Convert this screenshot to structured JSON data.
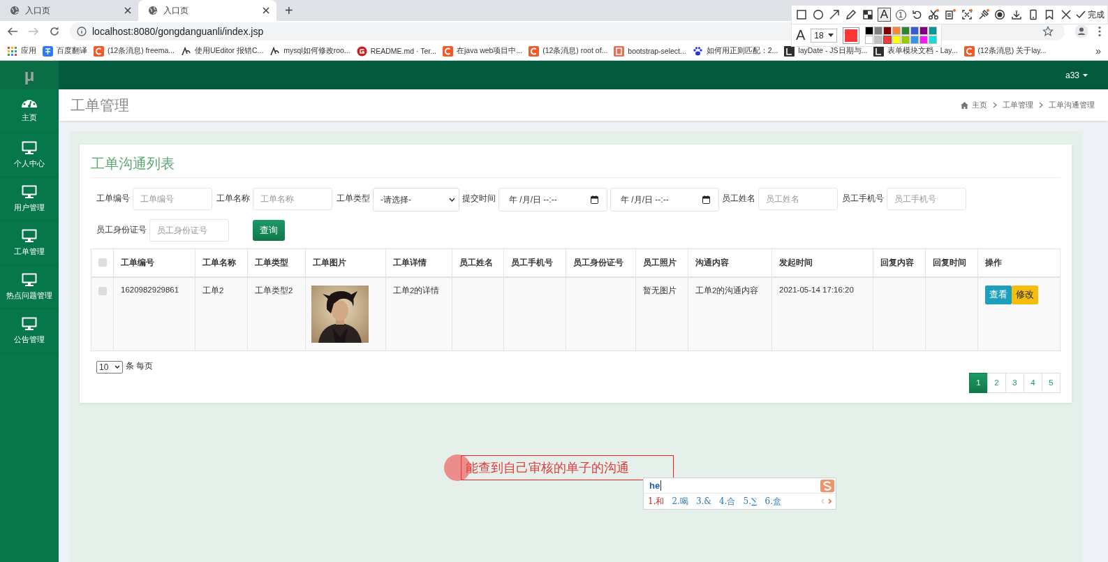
{
  "browser": {
    "tabs": [
      {
        "title": "入口页",
        "selected": false
      },
      {
        "title": "入口页",
        "selected": true
      }
    ],
    "new_tab": "+",
    "url": "localhost:8080/gongdanguanli/index.jsp",
    "bookmarks": [
      {
        "label": "应用",
        "kind": "apps"
      },
      {
        "label": "百度翻译",
        "kind": "translate"
      },
      {
        "label": "(12条消息) freema...",
        "kind": "csdn"
      },
      {
        "label": "使用UEditor 报错C...",
        "kind": "swirl"
      },
      {
        "label": "mysql如何修改roo...",
        "kind": "swirl"
      },
      {
        "label": "README.md · Ter...",
        "kind": "gitee"
      },
      {
        "label": "在java web项目中...",
        "kind": "csdn"
      },
      {
        "label": "(12条消息) root of...",
        "kind": "csdn"
      },
      {
        "label": "bootstrap-select...",
        "kind": "jian"
      },
      {
        "label": "如何用正则匹配：2...",
        "kind": "paw"
      },
      {
        "label": "layDate - JS日期与...",
        "kind": "layui"
      },
      {
        "label": "表单模块文档 - Lay...",
        "kind": "layui"
      },
      {
        "label": "(12条消息) 关于lay...",
        "kind": "csdn"
      }
    ],
    "bookmarks_more": "»"
  },
  "snip_toolbar": {
    "tools": [
      {
        "kind": "rect",
        "selected": false
      },
      {
        "kind": "circle",
        "selected": false
      },
      {
        "kind": "arrow",
        "selected": false
      },
      {
        "kind": "pencil",
        "selected": false
      },
      {
        "kind": "mosaic",
        "selected": false
      },
      {
        "kind": "text",
        "label": "A",
        "selected": true
      },
      {
        "kind": "number",
        "label": "1",
        "selected": false
      },
      {
        "kind": "undo",
        "selected": false
      },
      {
        "kind": "cut",
        "selected": false
      },
      {
        "kind": "ocr",
        "selected": false
      },
      {
        "kind": "scan",
        "selected": false
      },
      {
        "kind": "pin",
        "selected": false
      },
      {
        "kind": "record",
        "selected": false
      },
      {
        "kind": "download",
        "selected": false
      },
      {
        "kind": "phone",
        "selected": false
      },
      {
        "kind": "bookmark",
        "selected": false
      },
      {
        "kind": "close",
        "selected": false
      }
    ],
    "done": "完成",
    "font_icon": "A",
    "font_size": "18",
    "palette": [
      {
        "color": "#000000",
        "selected": false
      },
      {
        "color": "#808080",
        "selected": false
      },
      {
        "color": "#800000",
        "selected": false
      },
      {
        "color": "#f7883a",
        "selected": false
      },
      {
        "color": "#308430",
        "selected": false
      },
      {
        "color": "#385ad3",
        "selected": false
      },
      {
        "color": "#800080",
        "selected": false
      },
      {
        "color": "#009999",
        "selected": false
      },
      {
        "color": "#ffffff",
        "selected": false
      },
      {
        "color": "#c0c0c0",
        "selected": false
      },
      {
        "color": "#fb3838",
        "selected": true
      },
      {
        "color": "#ffff00",
        "selected": false
      },
      {
        "color": "#99cc00",
        "selected": false
      },
      {
        "color": "#3894e4",
        "selected": false
      },
      {
        "color": "#f31bf3",
        "selected": false
      },
      {
        "color": "#16dcdc",
        "selected": false
      }
    ]
  },
  "app": {
    "logo": "μ",
    "user": "a33"
  },
  "sidebar": {
    "items": [
      {
        "label": "主页",
        "kind": "dashboard"
      },
      {
        "label": "个人中心",
        "kind": "monitor"
      },
      {
        "label": "用户管理",
        "kind": "monitor"
      },
      {
        "label": "工单管理",
        "kind": "monitor"
      },
      {
        "label": "热点问题管理",
        "kind": "monitor"
      },
      {
        "label": "公告管理",
        "kind": "monitor"
      }
    ]
  },
  "page": {
    "title": "工单管理",
    "breadcrumb": [
      "主页",
      "工单管理",
      "工单沟通管理"
    ]
  },
  "card": {
    "title": "工单沟通列表",
    "filters": [
      {
        "kind": "text",
        "label": "工单编号",
        "placeholder": "工单编号"
      },
      {
        "kind": "text",
        "label": "工单名称",
        "placeholder": "工单名称"
      },
      {
        "kind": "select",
        "label": "工单类型",
        "value": "-请选择-"
      },
      {
        "kind": "daterange",
        "label": "提交时间",
        "values": [
          "年 /月/日 --:--",
          "年 /月/日 --:--"
        ]
      },
      {
        "kind": "text",
        "label": "员工姓名",
        "placeholder": "员工姓名"
      },
      {
        "kind": "text",
        "label": "员工手机号",
        "placeholder": "员工手机号"
      },
      {
        "kind": "text",
        "label": "员工身份证号",
        "placeholder": "员工身份证号"
      }
    ],
    "search_button": "查询"
  },
  "table": {
    "select_all": {
      "checked": false
    },
    "columns": [
      "工单编号",
      "工单名称",
      "工单类型",
      "工单图片",
      "工单详情",
      "员工姓名",
      "员工手机号",
      "员工身份证号",
      "员工照片",
      "沟通内容",
      "发起时间",
      "回复内容",
      "回复时间",
      "操作"
    ],
    "rows": [
      {
        "checked": false,
        "cells": [
          {
            "kind": "text",
            "text": "1620982929861"
          },
          {
            "kind": "text",
            "text": "工单2"
          },
          {
            "kind": "text",
            "text": "工单类型2"
          },
          {
            "kind": "picture"
          },
          {
            "kind": "text",
            "text": "工单2的详情"
          },
          {
            "kind": "empty"
          },
          {
            "kind": "empty"
          },
          {
            "kind": "empty"
          },
          {
            "kind": "text",
            "text": "暂无图片"
          },
          {
            "kind": "text",
            "text": "工单2的沟通内容"
          },
          {
            "kind": "text",
            "text": "2021-05-14 17:16:20"
          },
          {
            "kind": "empty"
          },
          {
            "kind": "empty"
          },
          {
            "kind": "actions",
            "buttons": [
              {
                "label": "查看",
                "kind": "info"
              },
              {
                "label": "修改",
                "kind": "warning"
              }
            ]
          }
        ]
      }
    ]
  },
  "page_size": {
    "value": "10",
    "suffix": "条 每页"
  },
  "pagination": [
    {
      "label": "1",
      "selected": true
    },
    {
      "label": "2",
      "selected": false
    },
    {
      "label": "3",
      "selected": false
    },
    {
      "label": "4",
      "selected": false
    },
    {
      "label": "5",
      "selected": false
    }
  ],
  "annotation": {
    "text": "能查到自己审核的单子的沟通"
  },
  "ime": {
    "input": "he",
    "candidates": [
      {
        "label": "1.和",
        "selected": true
      },
      {
        "label": "2.喝",
        "selected": false
      },
      {
        "label": "3.&",
        "selected": false
      },
      {
        "label": "4.合",
        "selected": false
      },
      {
        "label": "5.∑",
        "selected": false
      },
      {
        "label": "6.盒",
        "selected": false
      }
    ]
  }
}
